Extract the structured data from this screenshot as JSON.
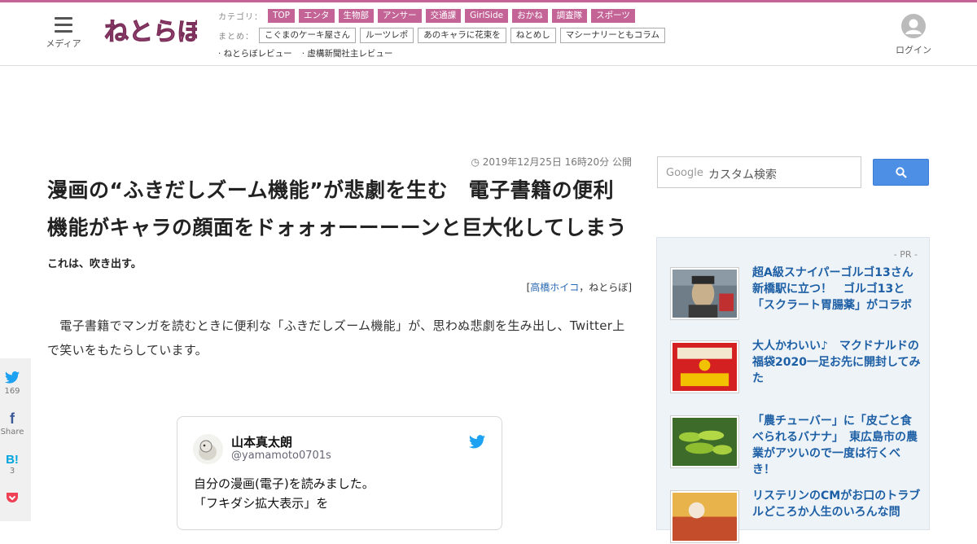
{
  "header": {
    "menu_label": "メディア",
    "logo_alt": "ねとらぼ",
    "category_label": "カテゴリ：",
    "categories": [
      "TOP",
      "エンタ",
      "生物部",
      "アンサー",
      "交通課",
      "GirlSide",
      "おかね",
      "調査隊",
      "スポーツ"
    ],
    "summary_label": "まとめ：",
    "summaries": [
      "こぐまのケーキ屋さん",
      "ルーツレポ",
      "あのキャラに花束を",
      "ねとめし",
      "マシーナリーともコラム"
    ],
    "extras": [
      "· ねとらぼレビュー",
      "· 虚構新聞社主レビュー"
    ],
    "login_label": "ログイン",
    "accent_color": "#c46496"
  },
  "article": {
    "date": "2019年12月25日 16時20分 公開",
    "title": "漫画の“ふきだしズーム機能”が悲劇を生む　電子書籍の便利機能がキャラの顔面をドォォォーーーーンと巨大化してしまう",
    "subtitle": "これは、吹き出す。",
    "byline_open": "[",
    "author": "高橋ホイコ",
    "byline_sep": "，",
    "publisher": "ねとらぼ",
    "byline_close": "]",
    "body": "　電子書籍でマンガを読むときに便利な「ふきだしズーム機能」が、思わぬ悲劇を生み出し、Twitter上で笑いをもたらしています。"
  },
  "tweet": {
    "name": "山本真太朗",
    "handle": "@yamamoto0701s",
    "line1": "自分の漫画(電子)を読みました。",
    "line2": "「フキダシ拡大表示」を",
    "icon": "twitter-bird-icon"
  },
  "share": {
    "twitter_count": "169",
    "facebook_label": "Share",
    "hatena_label": "B!",
    "hatena_count": "3"
  },
  "sidebar": {
    "search_brand": "Google",
    "search_placeholder": "カスタム検索",
    "pr_label": "- PR -",
    "pr_items": [
      {
        "text": "超A級スナイパーゴルゴ13さん新橋駅に立つ！　ゴルゴ13と「スクラート胃腸薬」がコラボ"
      },
      {
        "text": "大人かわいい♪　マクドナルドの福袋2020一足お先に開封してみた"
      },
      {
        "text": "「農チューバー」に「皮ごと食べられるバナナ」　東広島市の農業がアツいので一度は行くべき！"
      },
      {
        "text": "リステリンのCMがお口のトラブルどころか人生のいろんな問"
      }
    ],
    "link_color": "#1d5fa5"
  }
}
